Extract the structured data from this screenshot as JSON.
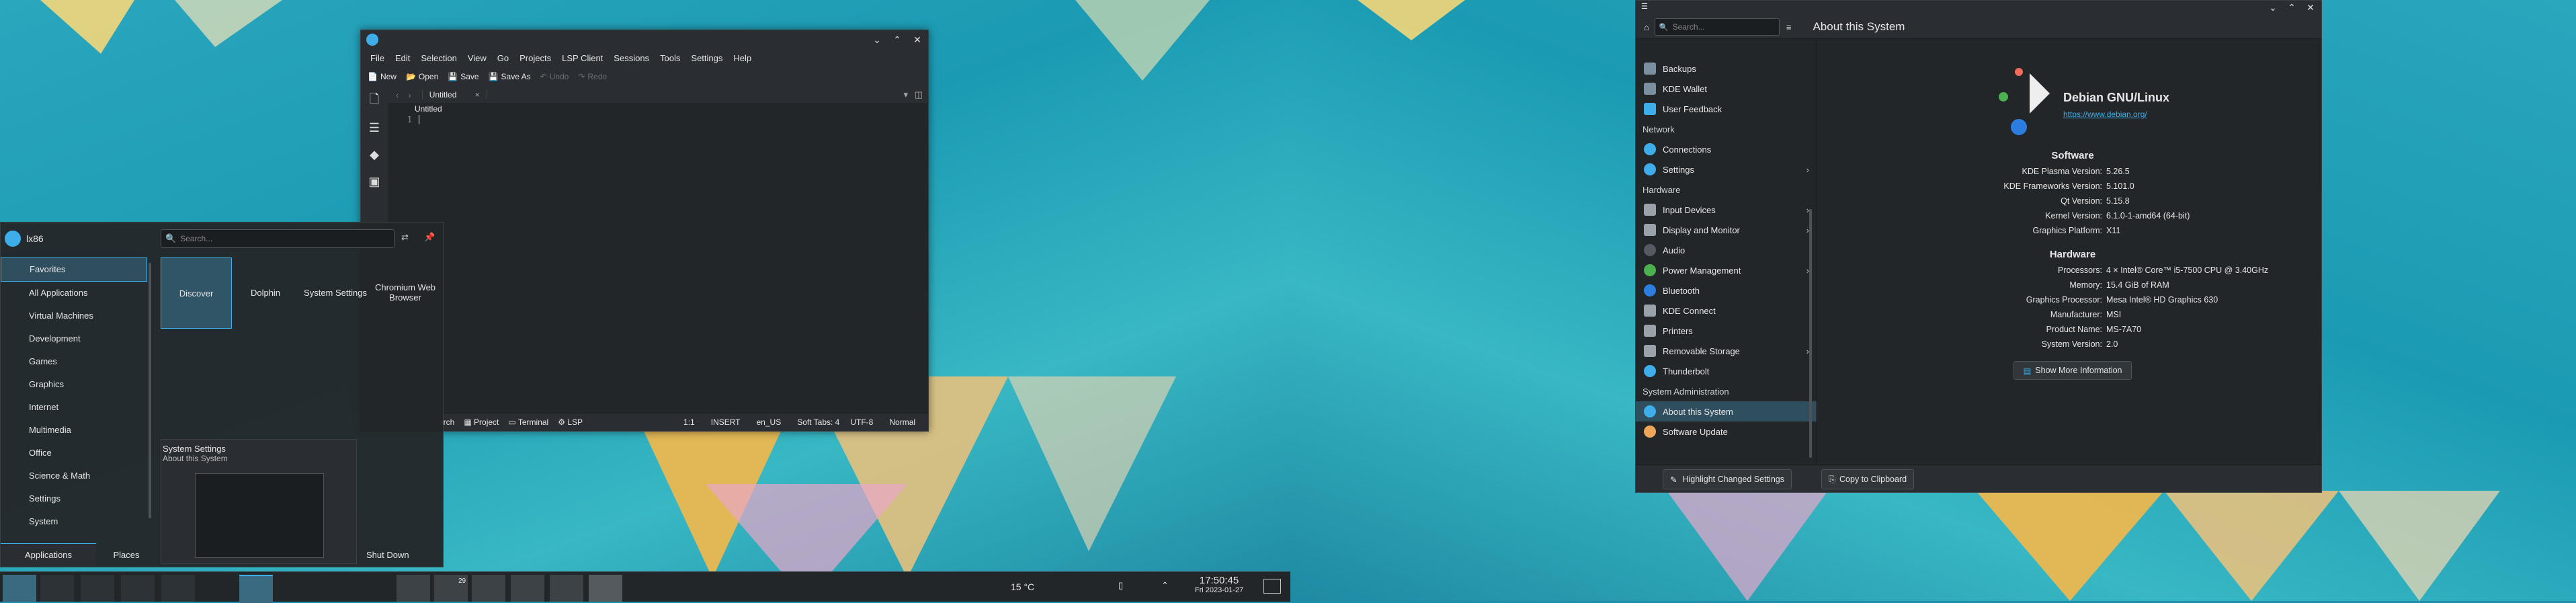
{
  "kate": {
    "menu": [
      "File",
      "Edit",
      "Selection",
      "View",
      "Go",
      "Projects",
      "LSP Client",
      "Sessions",
      "Tools",
      "Settings",
      "Help"
    ],
    "toolbar": {
      "new": "New",
      "open": "Open",
      "save": "Save",
      "save_as": "Save As",
      "undo": "Undo",
      "redo": "Redo"
    },
    "tab_label": "Untitled",
    "breadcrumb": "Untitled",
    "line_number": "1",
    "status": {
      "search": "arch",
      "project": "Project",
      "terminal": "Terminal",
      "lsp": "LSP",
      "position": "1:1",
      "mode": "INSERT",
      "lang": "en_US",
      "tabs": "Soft Tabs: 4",
      "encoding": "UTF-8",
      "syntax": "Normal"
    }
  },
  "launcher": {
    "user": "lx86",
    "search_placeholder": "Search...",
    "categories": [
      "Favorites",
      "All Applications",
      "Virtual Machines",
      "Development",
      "Games",
      "Graphics",
      "Internet",
      "Multimedia",
      "Office",
      "Science & Math",
      "Settings",
      "System"
    ],
    "favorites": [
      "Discover",
      "Dolphin",
      "System Settings",
      "Chromium Web Browser"
    ],
    "tooltip_title": "System Settings",
    "tooltip_sub": "About this System",
    "tabs": {
      "applications": "Applications",
      "places": "Places"
    },
    "shutdown": "Shut Down"
  },
  "taskbar": {
    "weather": "15 °C",
    "time": "17:50:45",
    "date": "Fri 2023-01-27",
    "badge": "29"
  },
  "settings": {
    "title": "About this System",
    "search_placeholder": "Search...",
    "nav": [
      {
        "label": "Backups",
        "color": "#7a8fa0"
      },
      {
        "label": "KDE Wallet",
        "color": "#7a8fa0"
      },
      {
        "label": "User Feedback",
        "color": "#3daee9"
      }
    ],
    "network_header": "Network",
    "network": [
      {
        "label": "Connections",
        "color": "#3daee9",
        "arrow": false
      },
      {
        "label": "Settings",
        "color": "#3daee9",
        "arrow": true
      }
    ],
    "hardware_header": "Hardware",
    "hardware": [
      {
        "label": "Input Devices",
        "color": "#9aa3aa",
        "arrow": true
      },
      {
        "label": "Display and Monitor",
        "color": "#9aa3aa",
        "arrow": true
      },
      {
        "label": "Audio",
        "color": "#555b61",
        "arrow": false
      },
      {
        "label": "Power Management",
        "color": "#4caf50",
        "arrow": true
      },
      {
        "label": "Bluetooth",
        "color": "#2d7de0",
        "arrow": false
      },
      {
        "label": "KDE Connect",
        "color": "#9aa3aa",
        "arrow": false
      },
      {
        "label": "Printers",
        "color": "#9aa3aa",
        "arrow": false
      },
      {
        "label": "Removable Storage",
        "color": "#9aa3aa",
        "arrow": true
      },
      {
        "label": "Thunderbolt",
        "color": "#3daee9",
        "arrow": false
      }
    ],
    "sysadmin_header": "System Administration",
    "sysadmin": [
      {
        "label": "About this System",
        "color": "#3daee9",
        "selected": true
      },
      {
        "label": "Software Update",
        "color": "#f0a65a",
        "selected": false
      }
    ],
    "distro": "Debian GNU/Linux",
    "url": "https://www.debian.org/",
    "software_header": "Software",
    "software": [
      {
        "k": "KDE Plasma Version:",
        "v": "5.26.5"
      },
      {
        "k": "KDE Frameworks Version:",
        "v": "5.101.0"
      },
      {
        "k": "Qt Version:",
        "v": "5.15.8"
      },
      {
        "k": "Kernel Version:",
        "v": "6.1.0-1-amd64 (64-bit)"
      },
      {
        "k": "Graphics Platform:",
        "v": "X11"
      }
    ],
    "hardware_info_header": "Hardware",
    "hardware_info": [
      {
        "k": "Processors:",
        "v": "4 × Intel® Core™ i5-7500 CPU @ 3.40GHz"
      },
      {
        "k": "Memory:",
        "v": "15.4 GiB of RAM"
      },
      {
        "k": "Graphics Processor:",
        "v": "Mesa Intel® HD Graphics 630"
      },
      {
        "k": "Manufacturer:",
        "v": "MSI"
      },
      {
        "k": "Product Name:",
        "v": "MS-7A70"
      },
      {
        "k": "System Version:",
        "v": "2.0"
      }
    ],
    "show_more": "Show More Information",
    "highlight": "Highlight Changed Settings",
    "copy": "Copy to Clipboard"
  }
}
